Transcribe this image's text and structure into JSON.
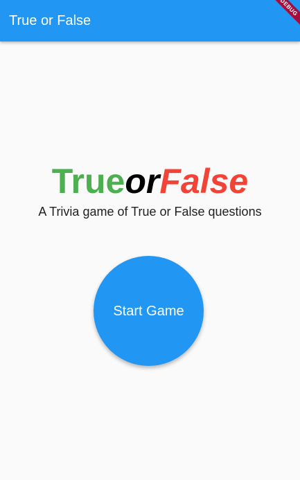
{
  "app_bar": {
    "title": "True or False",
    "color": "#2196f3"
  },
  "debug_banner": {
    "label": "DEBUG"
  },
  "logo": {
    "part_true": "True",
    "part_or": "or",
    "part_false": "False",
    "colors": {
      "true": "#4caf50",
      "or": "#000000",
      "false": "#f44336"
    }
  },
  "subtitle": "A Trivia game of True or False questions",
  "start_button": {
    "label": "Start Game",
    "color": "#2196f3"
  }
}
